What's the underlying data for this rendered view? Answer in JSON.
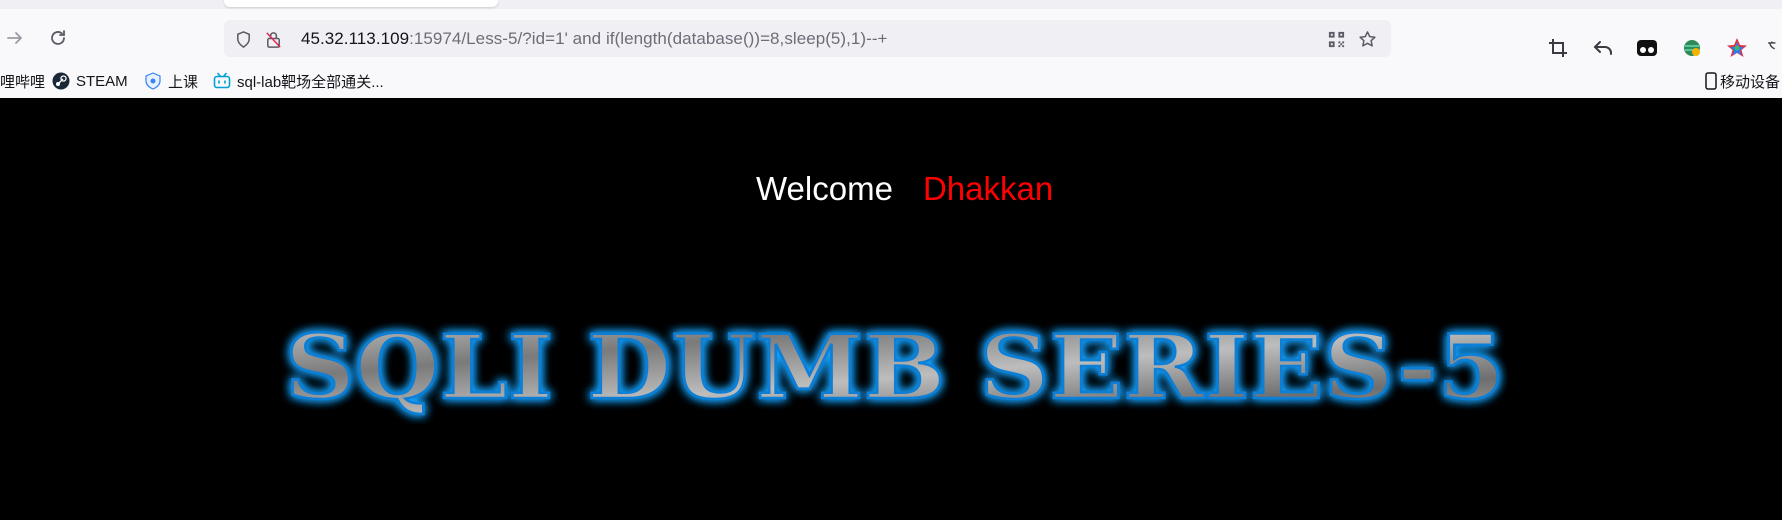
{
  "browser": {
    "url": {
      "host": "45.32.113.109",
      "rest": ":15974/Less-5/?id=1' and if(length(database())=8,sleep(5),1)--+"
    },
    "bookmarks": [
      {
        "label": "哩哔哩",
        "icon": "bilibili-icon"
      },
      {
        "label": "STEAM",
        "icon": "steam-icon"
      },
      {
        "label": "上课",
        "icon": "shield-icon"
      },
      {
        "label": "sql-lab靶场全部通关...",
        "icon": "bilibili-tv-icon"
      }
    ],
    "mobile_bookmarks": "移动设备"
  },
  "page": {
    "welcome": "Welcome",
    "name": "Dhakkan",
    "banner_title": "SQLI DUMB SERIES-5"
  },
  "colors": {
    "name": "#ff0000",
    "banner_glow": "#1aa3ff",
    "background": "#000000"
  }
}
